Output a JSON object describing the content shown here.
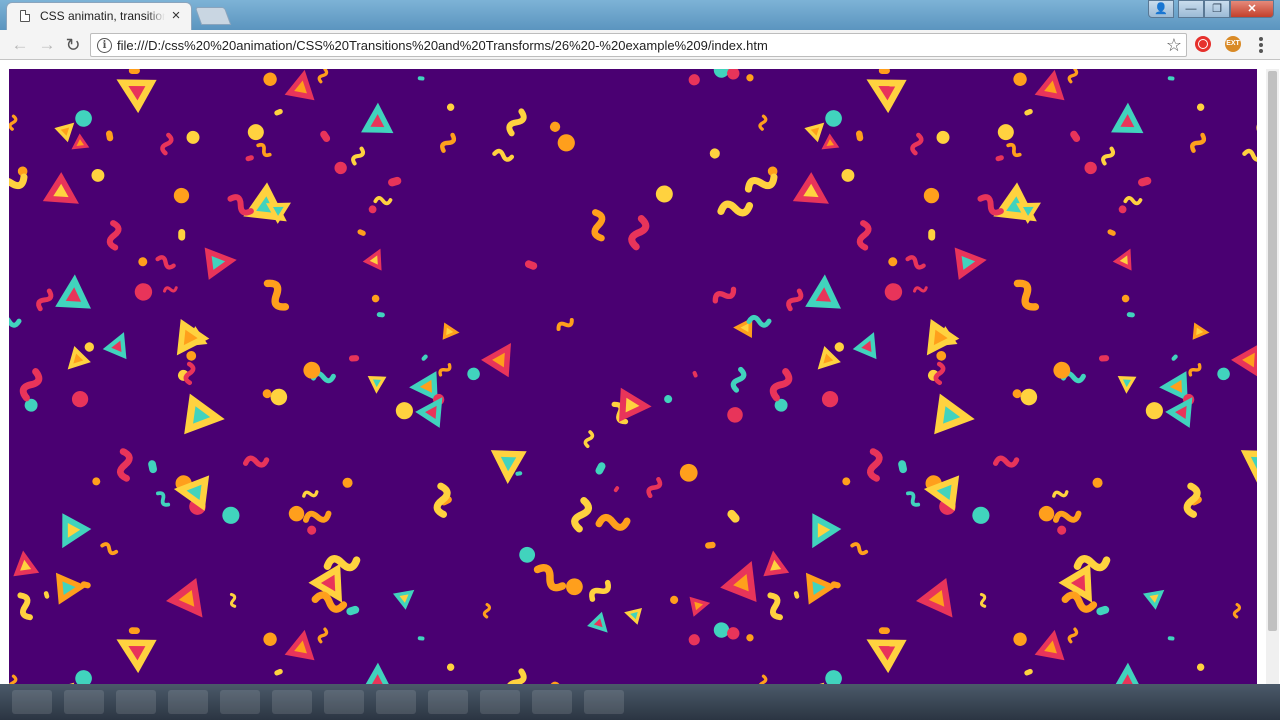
{
  "window": {
    "tab_title": "CSS animatin, transitions",
    "close_glyph": "×",
    "controls": {
      "user": "👤",
      "minimize": "—",
      "maximize": "❐",
      "close": "✕"
    }
  },
  "toolbar": {
    "back_glyph": "←",
    "forward_glyph": "→",
    "reload_glyph": "↻",
    "info_glyph": "i",
    "url": "file:///D:/css%20%20animation/CSS%20Transitions%20and%20Transforms/26%20-%20example%209/index.htm",
    "star_glyph": "☆",
    "extension_2_label": "EXT"
  },
  "page": {
    "background_color": "#4a0072",
    "shape_colors": [
      "#ffd23f",
      "#41d3bd",
      "#e8345a",
      "#ff9f1c"
    ]
  }
}
